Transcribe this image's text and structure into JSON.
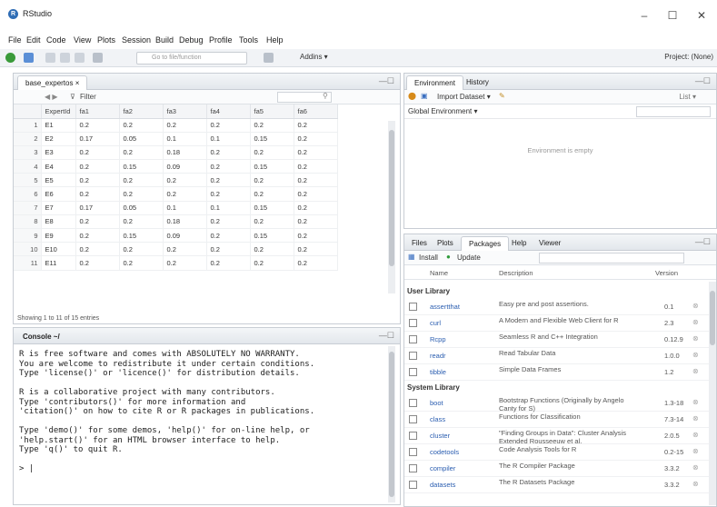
{
  "window": {
    "title": "RStudio"
  },
  "menu": [
    "File",
    "Edit",
    "Code",
    "View",
    "Plots",
    "Session",
    "Build",
    "Debug",
    "Profile",
    "Tools",
    "Help"
  ],
  "toolbar": {
    "goto_placeholder": "Go to file/function",
    "addins": "Addins ▾",
    "project": "Project: (None)"
  },
  "data_viewer": {
    "tab": "base_expertos ×",
    "filter": "Filter",
    "columns": [
      "",
      "ExpertId",
      "fa1",
      "fa2",
      "fa3",
      "fa4",
      "fa5",
      "fa6"
    ],
    "rows": [
      [
        "1",
        "E1",
        "0.2",
        "0.2",
        "0.2",
        "0.2",
        "0.2",
        "0.2"
      ],
      [
        "2",
        "E2",
        "0.17",
        "0.05",
        "0.1",
        "0.1",
        "0.15",
        "0.2"
      ],
      [
        "3",
        "E3",
        "0.2",
        "0.2",
        "0.18",
        "0.2",
        "0.2",
        "0.2"
      ],
      [
        "4",
        "E4",
        "0.2",
        "0.15",
        "0.09",
        "0.2",
        "0.15",
        "0.2"
      ],
      [
        "5",
        "E5",
        "0.2",
        "0.2",
        "0.2",
        "0.2",
        "0.2",
        "0.2"
      ],
      [
        "6",
        "E6",
        "0.2",
        "0.2",
        "0.2",
        "0.2",
        "0.2",
        "0.2"
      ],
      [
        "7",
        "E7",
        "0.17",
        "0.05",
        "0.1",
        "0.1",
        "0.15",
        "0.2"
      ],
      [
        "8",
        "E8",
        "0.2",
        "0.2",
        "0.18",
        "0.2",
        "0.2",
        "0.2"
      ],
      [
        "9",
        "E9",
        "0.2",
        "0.15",
        "0.09",
        "0.2",
        "0.15",
        "0.2"
      ],
      [
        "10",
        "E10",
        "0.2",
        "0.2",
        "0.2",
        "0.2",
        "0.2",
        "0.2"
      ],
      [
        "11",
        "E11",
        "0.2",
        "0.2",
        "0.2",
        "0.2",
        "0.2",
        "0.2"
      ]
    ],
    "showing": "Showing 1 to 11 of 15 entries"
  },
  "console": {
    "tab": "Console ~/",
    "lines": [
      "R is free software and comes with ABSOLUTELY NO WARRANTY.",
      "You are welcome to redistribute it under certain conditions.",
      "Type 'license()' or 'licence()' for distribution details.",
      "",
      "R is a collaborative project with many contributors.",
      "Type 'contributors()' for more information and",
      "'citation()' on how to cite R or R packages in publications.",
      "",
      "Type 'demo()' for some demos, 'help()' for on-line help, or",
      "'help.start()' for an HTML browser interface to help.",
      "Type 'q()' to quit R.",
      "",
      "> |"
    ]
  },
  "environment": {
    "tabs": [
      "Environment",
      "History"
    ],
    "import": "Import Dataset ▾",
    "list": "List ▾",
    "scope": "Global Environment ▾",
    "empty": "Environment is empty"
  },
  "packages_pane": {
    "tabs": [
      "Files",
      "Plots",
      "Packages",
      "Help",
      "Viewer"
    ],
    "install": "Install",
    "update": "Update",
    "col_name": "Name",
    "col_desc": "Description",
    "col_ver": "Version",
    "user_library": "User Library",
    "system_library": "System Library",
    "user_pkgs": [
      {
        "name": "assertthat",
        "desc": "Easy pre and post assertions.",
        "ver": "0.1"
      },
      {
        "name": "curl",
        "desc": "A Modern and Flexible Web Client for R",
        "ver": "2.3"
      },
      {
        "name": "Rcpp",
        "desc": "Seamless R and C++ Integration",
        "ver": "0.12.9"
      },
      {
        "name": "readr",
        "desc": "Read Tabular Data",
        "ver": "1.0.0"
      },
      {
        "name": "tibble",
        "desc": "Simple Data Frames",
        "ver": "1.2"
      }
    ],
    "system_pkgs": [
      {
        "name": "boot",
        "desc": "Bootstrap Functions (Originally by Angelo Canty for S)",
        "ver": "1.3-18"
      },
      {
        "name": "class",
        "desc": "Functions for Classification",
        "ver": "7.3-14"
      },
      {
        "name": "cluster",
        "desc": "\"Finding Groups in Data\": Cluster Analysis Extended Rousseeuw et al.",
        "ver": "2.0.5"
      },
      {
        "name": "codetools",
        "desc": "Code Analysis Tools for R",
        "ver": "0.2-15"
      },
      {
        "name": "compiler",
        "desc": "The R Compiler Package",
        "ver": "3.3.2"
      },
      {
        "name": "datasets",
        "desc": "The R Datasets Package",
        "ver": "3.3.2"
      }
    ]
  }
}
